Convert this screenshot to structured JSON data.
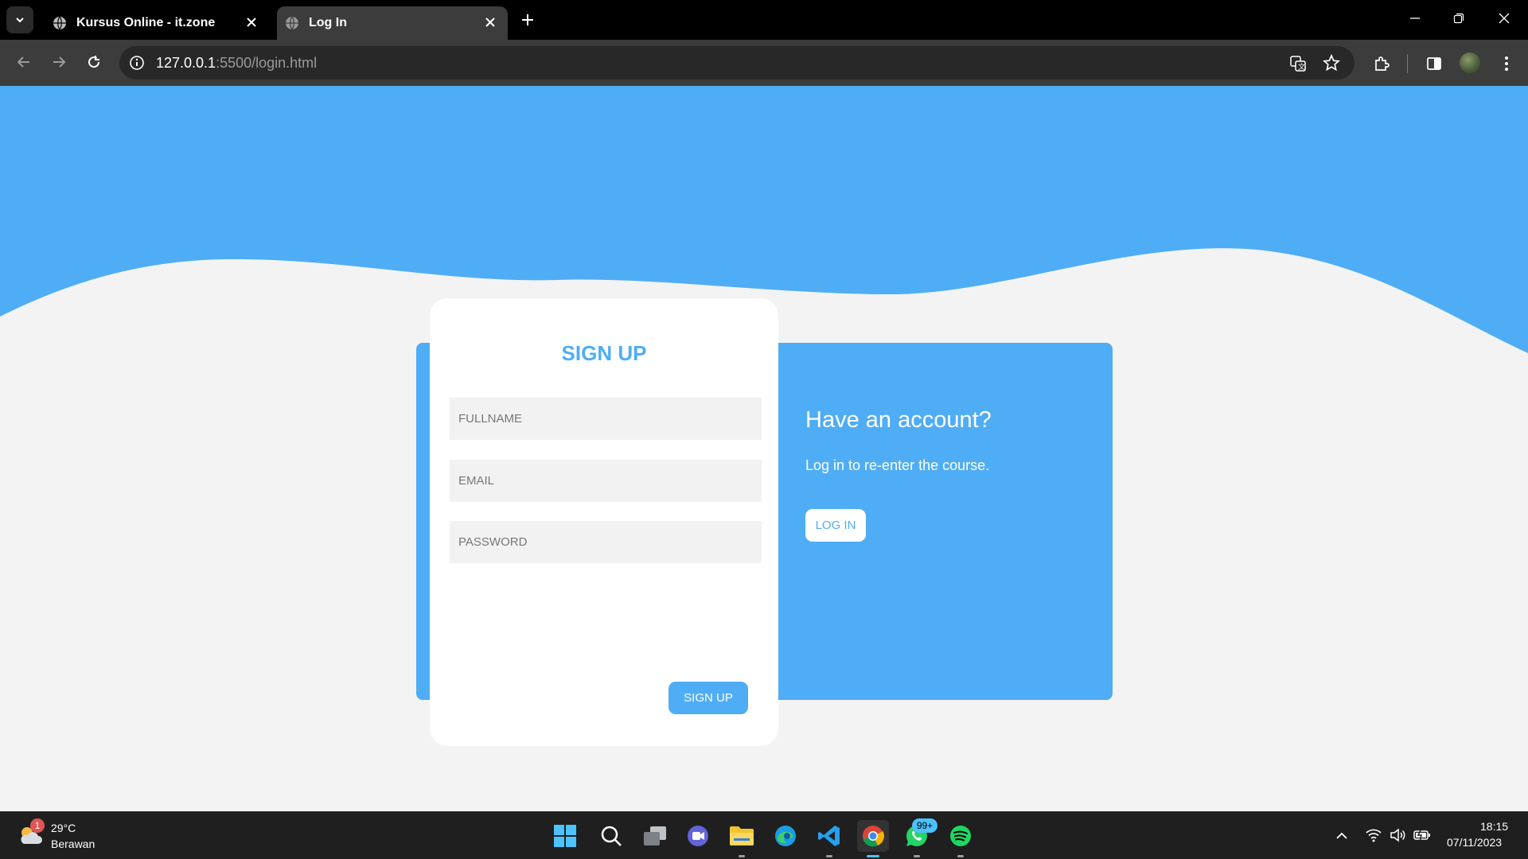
{
  "browser": {
    "tabs": [
      {
        "title": "Kursus Online - it.zone",
        "active": false
      },
      {
        "title": "Log In",
        "active": true
      }
    ],
    "url_host": "127.0.0.1",
    "url_path": ":5500/login.html"
  },
  "page": {
    "signup": {
      "title": "SIGN UP",
      "fullname_placeholder": "FULLNAME",
      "email_placeholder": "EMAIL",
      "password_placeholder": "PASSWORD",
      "button": "SIGN UP"
    },
    "login_panel": {
      "title": "Have an account?",
      "text": "Log in to re-enter the course.",
      "button": "LOG IN"
    },
    "colors": {
      "accent": "#4fadf5",
      "background": "#f3f3f3"
    }
  },
  "taskbar": {
    "weather_temp": "29°C",
    "weather_desc": "Berawan",
    "weather_badge": "1",
    "whatsapp_badge": "99+",
    "time": "18:15",
    "date": "07/11/2023"
  }
}
